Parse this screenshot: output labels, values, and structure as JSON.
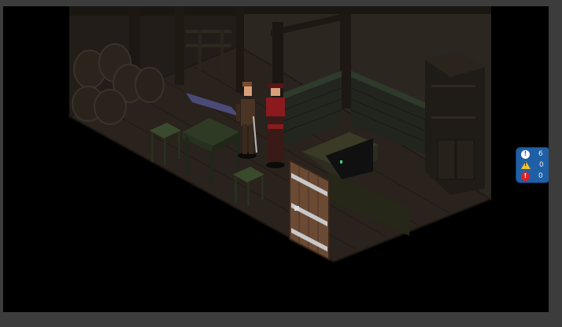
{
  "scene": {
    "description_tag": "tavern-cellar-isometric",
    "colors": {
      "background": "#000000",
      "frame": "#3c3c3c",
      "floor": "#2a221c",
      "wall": "#2b2620",
      "brick": "#23251f",
      "wood": "#4a3626",
      "table": "#2f3a25",
      "door": "#6b4a34",
      "character_red": "#8a1a1e"
    }
  },
  "console": {
    "info_icon": "info-icon",
    "warning_icon": "warning-icon",
    "error_icon": "error-icon",
    "info_count": "6",
    "warning_count": "0",
    "error_count": "0",
    "colors": {
      "panel": "#1f5fa6",
      "info": "#ffffff",
      "warning": "#f2c230",
      "error": "#e02020"
    }
  }
}
